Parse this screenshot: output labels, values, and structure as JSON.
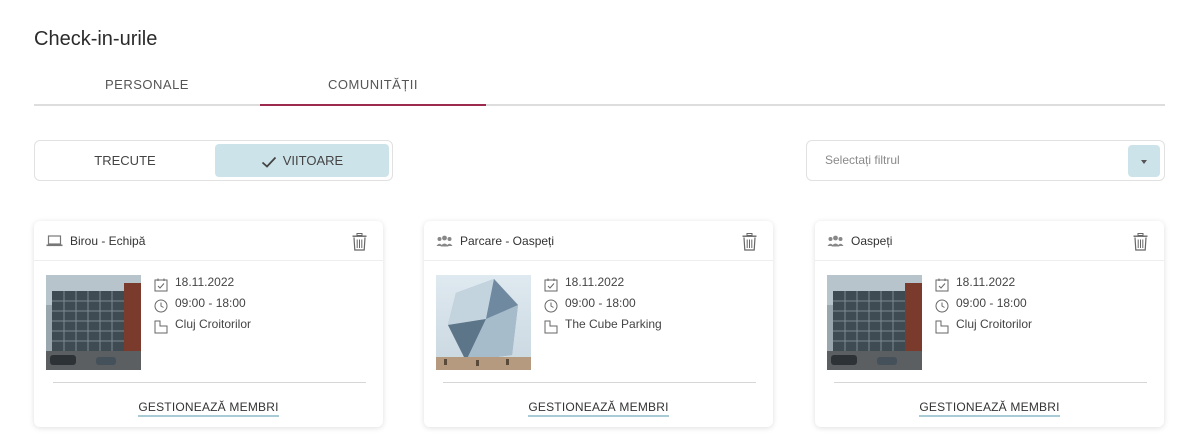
{
  "page": {
    "title": "Check-in-urile"
  },
  "tabs": [
    {
      "label": "PERSONALE",
      "active": false
    },
    {
      "label": "COMUNITĂȚII",
      "active": true
    }
  ],
  "segment": {
    "past_label": "TRECUTE",
    "upcoming_label": "VIITOARE",
    "selected": "upcoming"
  },
  "filter": {
    "placeholder": "Selectați filtrul"
  },
  "colors": {
    "accent": "#9c2a4e",
    "selected_bg": "#cde3ea",
    "link_underline": "#a9cbd6"
  },
  "cards": [
    {
      "type_icon": "laptop-icon",
      "title": "Birou - Echipă",
      "date": "18.11.2022",
      "time": "09:00 - 18:00",
      "location": "Cluj Croitorilor",
      "image": "office-building",
      "action": "GESTIONEAZĂ MEMBRI"
    },
    {
      "type_icon": "group-icon",
      "title": "Parcare - Oaspeți",
      "date": "18.11.2022",
      "time": "09:00 - 18:00",
      "location": "The Cube Parking",
      "image": "glass-cube-building",
      "action": "GESTIONEAZĂ MEMBRI"
    },
    {
      "type_icon": "group-icon",
      "title": "Oaspeți",
      "date": "18.11.2022",
      "time": "09:00 - 18:00",
      "location": "Cluj Croitorilor",
      "image": "office-building",
      "action": "GESTIONEAZĂ MEMBRI"
    }
  ]
}
